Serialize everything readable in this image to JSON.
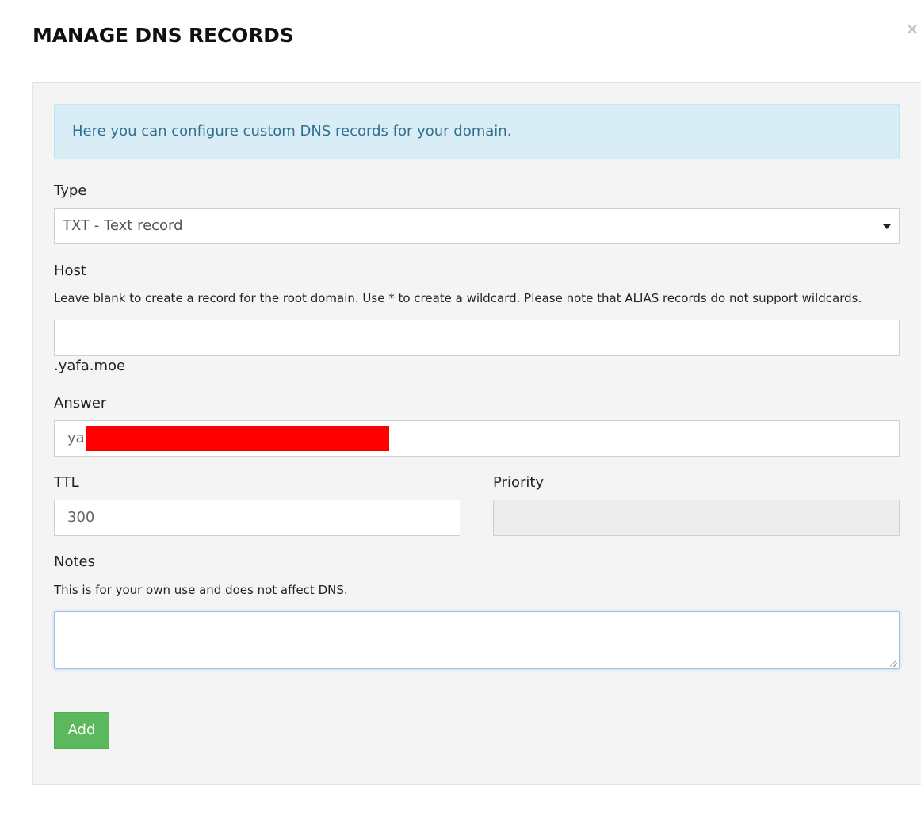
{
  "modal": {
    "title": "MANAGE DNS RECORDS",
    "close_glyph": "×"
  },
  "info": {
    "text": "Here you can configure custom DNS records for your domain."
  },
  "form": {
    "type": {
      "label": "Type",
      "selected": "TXT - Text record"
    },
    "host": {
      "label": "Host",
      "help": "Leave blank to create a record for the root domain. Use * to create a wildcard. Please note that ALIAS records do not support wildcards.",
      "value": "",
      "suffix": ".yafa.moe"
    },
    "answer": {
      "label": "Answer",
      "value": "ya"
    },
    "ttl": {
      "label": "TTL",
      "value": "300"
    },
    "priority": {
      "label": "Priority",
      "value": ""
    },
    "notes": {
      "label": "Notes",
      "help": "This is for your own use and does not affect DNS.",
      "value": ""
    },
    "submit_label": "Add"
  },
  "colors": {
    "info_bg": "#d9edf7",
    "info_text": "#31708f",
    "button_green": "#5cb85c",
    "redaction": "#ff0000",
    "panel_bg": "#f4f4f4"
  },
  "icons": {
    "close": "close-icon",
    "dropdown": "chevron-down-icon"
  }
}
